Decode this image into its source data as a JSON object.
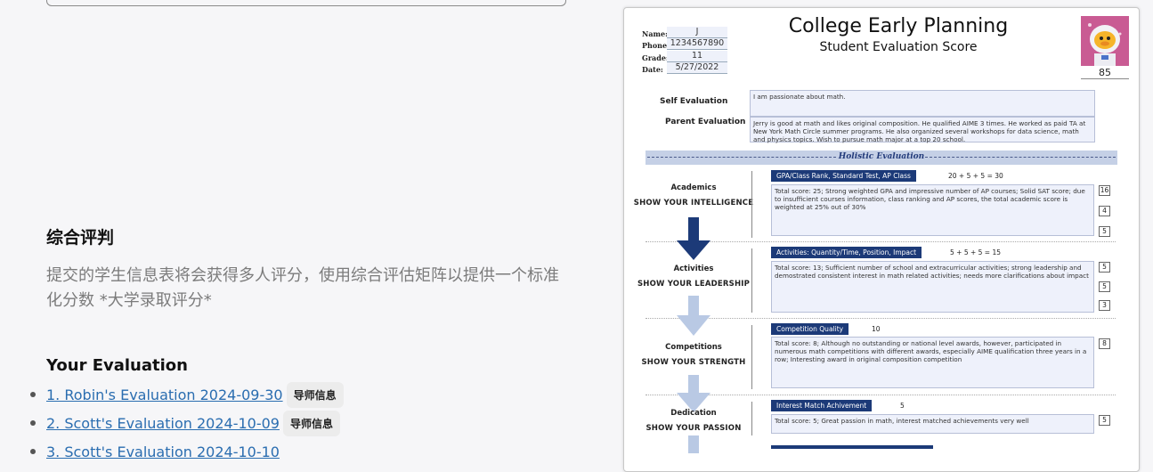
{
  "left": {
    "section_title": "综合评判",
    "section_desc": "提交的学生信息表将会获得多人评分，使用综合评估矩阵以提供一个标准化分数    *大学录取评分*",
    "eval_title": "Your Evaluation",
    "evaluations": [
      {
        "label": "1. Robin's Evaluation 2024-09-30",
        "tag": "导师信息"
      },
      {
        "label": "2. Scott's Evaluation 2024-10-09",
        "tag": "导师信息"
      },
      {
        "label": "3. Scott's Evaluation 2024-10-10",
        "tag": ""
      }
    ]
  },
  "sheet": {
    "title": "College Early Planning",
    "subtitle": "Student Evaluation Score",
    "info": {
      "name_label": "Name:",
      "name": "J",
      "phone_label": "Phone:",
      "phone": "1234567890",
      "grade_label": "Grade:",
      "grade": "11",
      "date_label": "Date:",
      "date": "5/27/2022"
    },
    "total_score": "85",
    "self_eval_label": "Self Evaluation",
    "self_eval": "I am passionate about math.",
    "parent_eval_label": "Parent Evaluation",
    "parent_eval": "Jerry is good at math and likes original composition. He qualified AIME 3 times. He worked as paid TA at New York Math Circle summer programs. He also organized several workshops for data science, math and physics topics. Wish to pursue math major at a top 20 school.",
    "holistic_label": "Holistic Evaluation",
    "categories": [
      {
        "name": "Academics",
        "sub": "SHOW YOUR INTELLIGENCE",
        "pill": "GPA/Class Rank, Standard Test, AP Class",
        "formula": "20 + 5 + 5 = 30",
        "comment": "Total score: 25; Strong weighted GPA and impressive number of AP courses; Solid SAT score; due to insufficient courses information, class ranking and AP scores, the total academic score is weighted at 25% out of 30%",
        "scores": [
          "16",
          "4",
          "5"
        ]
      },
      {
        "name": "Activities",
        "sub": "SHOW YOUR LEADERSHIP",
        "pill": "Activities: Quantity/Time, Position, Impact",
        "formula": "5 + 5 + 5 = 15",
        "comment": "Total score: 13; Sufficient number of school and extracurricular activities; strong leadership and demostrated consistent interest in math related activities; needs more clarifications about impact",
        "scores": [
          "5",
          "5",
          "3"
        ]
      },
      {
        "name": "Competitions",
        "sub": "SHOW YOUR STRENGTH",
        "pill": "Competition Quality",
        "formula": "10",
        "comment": "Total score: 8; Although no outstanding or national level awards, however, participated in numerous math competitions with different awards, especially AIME qualification three years in a row; Interesting award in original composition competition",
        "scores": [
          "8"
        ]
      },
      {
        "name": "Dedication",
        "sub": "SHOW YOUR PASSION",
        "pill": "Interest Match Achivement",
        "formula": "5",
        "comment": "Total score: 5; Great passion in math, interest matched achievements very well",
        "scores": [
          "5"
        ]
      }
    ],
    "colors": {
      "pill": "#1c3a78",
      "arrow_dark": "#1c3a78",
      "arrow_light": "#b9c9e4",
      "band": "#c5d0e6"
    }
  }
}
